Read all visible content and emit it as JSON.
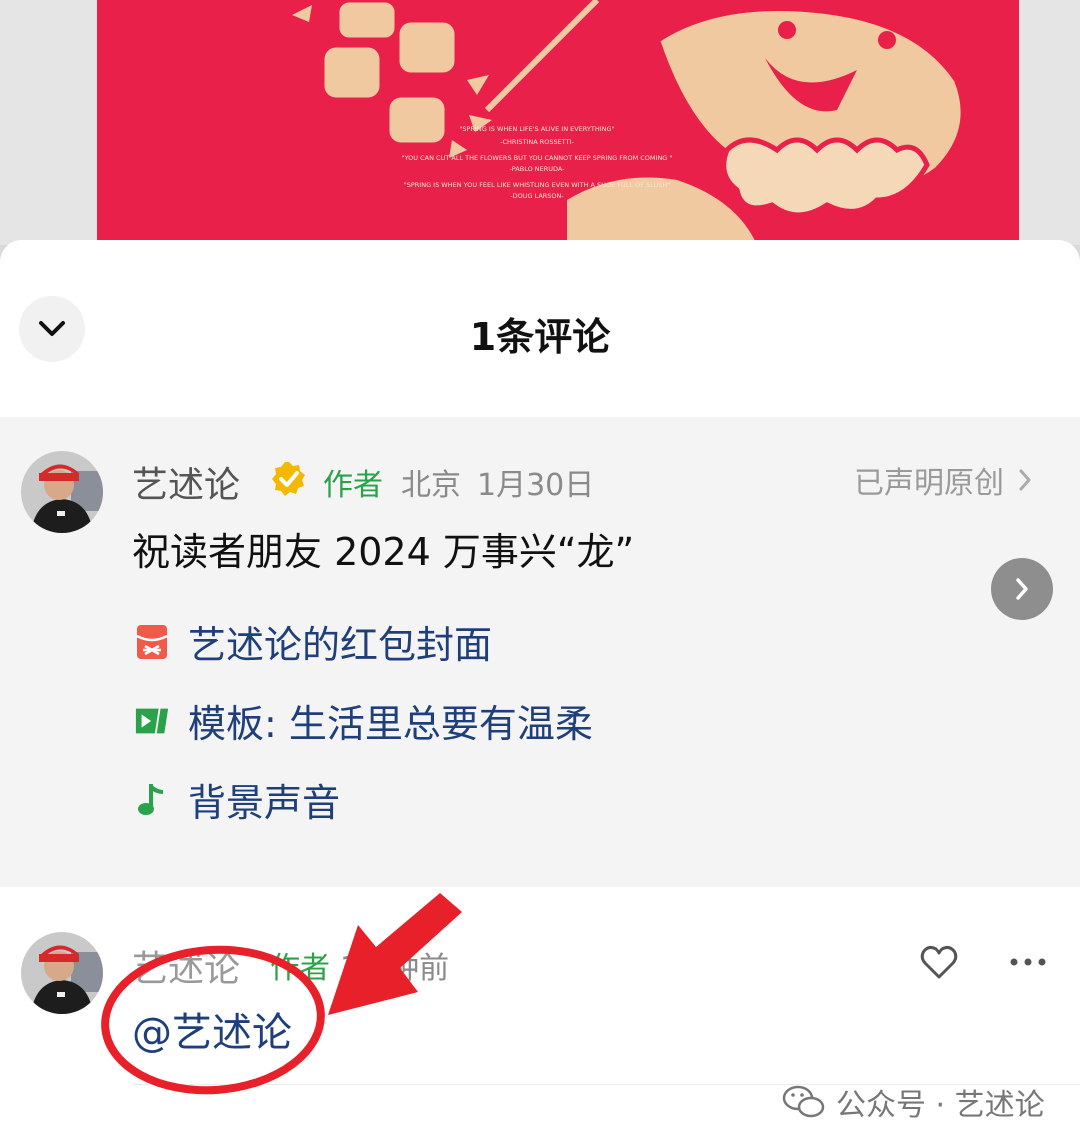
{
  "cover": {
    "quotes": [
      "\"SPRING IS WHEN LIFE'S ALIVE IN EVERYTHING\"",
      "-CHRISTINA ROSSETTI-",
      "\"YOU CAN CUT ALL THE FLOWERS BUT YOU CANNOT KEEP SPRING FROM COMING \"",
      "-PABLO NERUDA-",
      "\"SPRING IS WHEN YOU FEEL LIKE WHISTLING EVEN WITH A SHOE FULL OF SLUSH\"",
      "-DOUG LARSON-"
    ]
  },
  "sheet": {
    "title": "1条评论"
  },
  "post": {
    "author": "艺述论",
    "author_tag": "作者",
    "location": "北京",
    "date": "1月30日",
    "original_label": "已声明原创",
    "text": "祝读者朋友 2024 万事兴“龙”",
    "links": [
      {
        "icon": "red-envelope-icon",
        "label": "艺述论的红包封面"
      },
      {
        "icon": "template-icon",
        "label": "模板: 生活里总要有温柔"
      },
      {
        "icon": "music-note-icon",
        "label": "背景声音"
      }
    ]
  },
  "comment": {
    "author": "艺述论",
    "author_tag": "作者",
    "time": "1分钟前",
    "text": "@艺述论"
  },
  "watermark": {
    "text": "公众号 · 艺述论"
  },
  "colors": {
    "accent_green": "#2aa24a",
    "link_blue": "#1f3f7a",
    "annotation_red": "#e8202a",
    "cover_red": "#e8204a"
  }
}
